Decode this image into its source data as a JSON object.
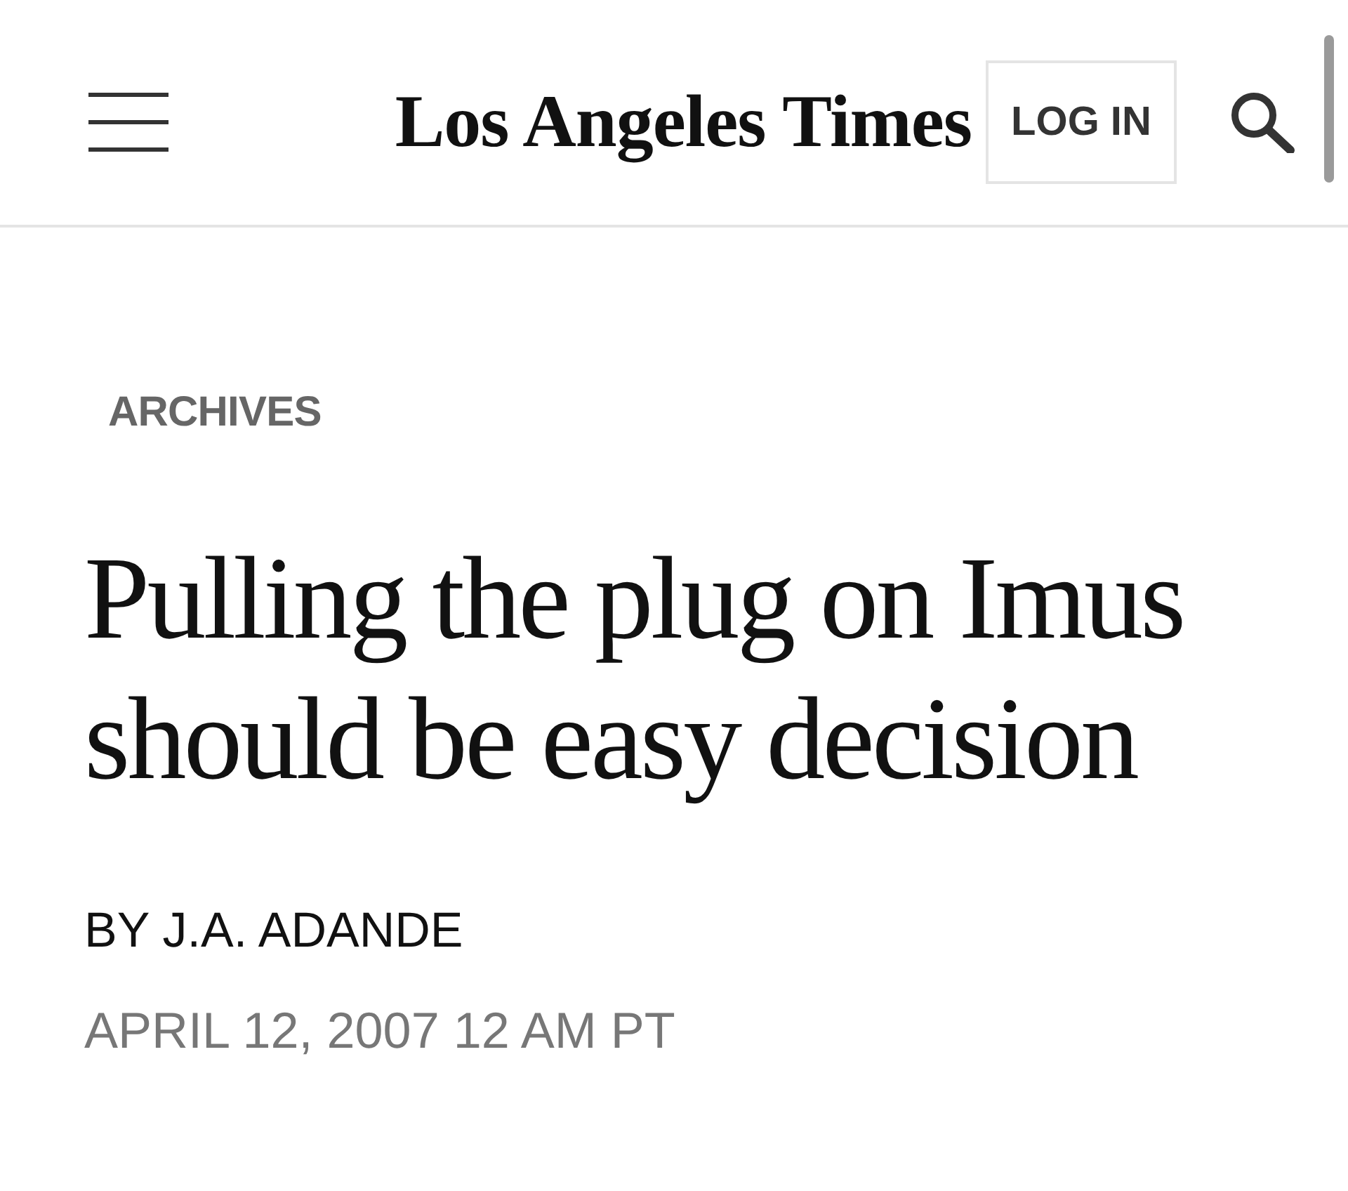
{
  "header": {
    "logo": "Los Angeles Times",
    "login_button": "LOG IN"
  },
  "article": {
    "section": "ARCHIVES",
    "headline": "Pulling the plug on Imus should be easy decision",
    "byline": "BY J.A. ADANDE",
    "dateline": "APRIL 12, 2007 12 AM PT"
  }
}
